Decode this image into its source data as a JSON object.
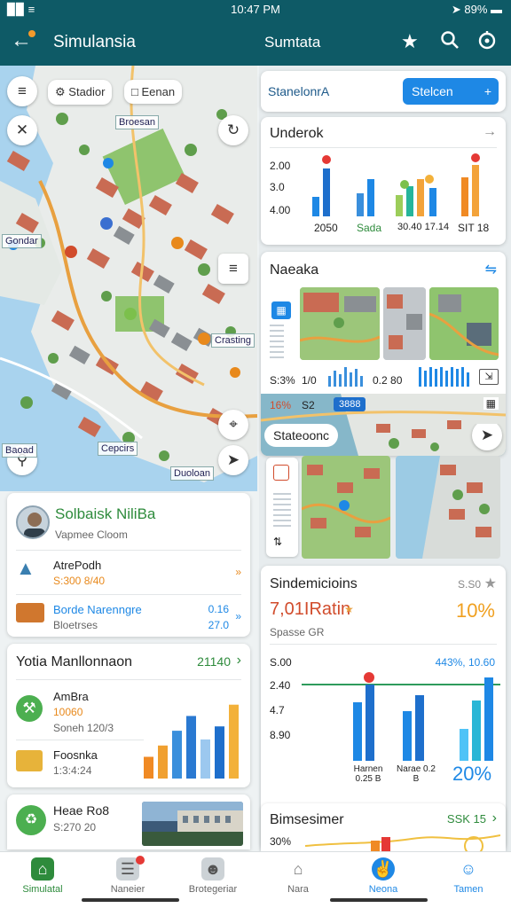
{
  "status": {
    "left": "▉▉ ≡",
    "time": "10:47 PM",
    "right": "➤ 89% ▬"
  },
  "appbar": {
    "title": "Simulansia",
    "center_title": "Sumtata"
  },
  "map": {
    "chip_1": "Stadior",
    "chip_2": "Eenan",
    "labels": [
      "Broesan",
      "Gondar",
      "Crasting",
      "Cepcirs",
      "Baoad",
      "Duoloan"
    ]
  },
  "profile": {
    "name": "Solbaisk NiliBa",
    "subtitle": "Vapmee Cloom",
    "rows": [
      {
        "title": "AtrePodh",
        "value": "S:300 8/40"
      },
      {
        "title": "Borde Narenngre",
        "value": "Bloetrses",
        "right_top": "0.16",
        "right_bottom": "27.0"
      }
    ]
  },
  "mainten": {
    "title": "Yotia Manllonnaon",
    "value": "21140",
    "rows": [
      {
        "title": "AmBra",
        "value": "10060",
        "sub": "Soneh 120/3"
      },
      {
        "title": "Foosnka",
        "value": "1:3:4:24"
      }
    ],
    "bars": [
      {
        "v": 0.25,
        "c": "#f08a24"
      },
      {
        "v": 0.38,
        "c": "#f0a030"
      },
      {
        "v": 0.55,
        "c": "#3a8fdc"
      },
      {
        "v": 0.72,
        "c": "#2a79d1"
      },
      {
        "v": 0.45,
        "c": "#9cc8ef"
      },
      {
        "v": 0.6,
        "c": "#1e6fcc"
      },
      {
        "v": 0.85,
        "c": "#f3b13a"
      }
    ]
  },
  "bottom_left": {
    "title": "Heae Ro8",
    "value": "S:270 20"
  },
  "right": {
    "search_value": "StanelonrA",
    "search_button": "Stelcen",
    "undero": {
      "title": "Underok",
      "yticks": [
        "2.00",
        "3.0",
        "4.00"
      ],
      "xlabels": [
        "2050",
        "Sada",
        "30.40 17.14",
        "SIT 18"
      ]
    },
    "naeaka": {
      "title": "Naeaka",
      "stat_1": "S:3%",
      "stat_2": "1/0",
      "stat_3": "0.2 80",
      "stat_4": "16%",
      "stat_5": "S2",
      "badge": "3888"
    },
    "stateoonc": {
      "title": "Stateoonc"
    },
    "sinde": {
      "title": "Sindemicioins",
      "corner": "S.S0",
      "big_left": "7,01IRatin",
      "big_right": "10%",
      "sub": "Spasse GR",
      "yticks": [
        "S.00",
        "2.40",
        "4.7",
        "8.90"
      ],
      "legend": "443%, 10.60",
      "xlabels": [
        "Harnen 0.25 B",
        "Narae 0.2 B"
      ],
      "percent": "20%"
    },
    "bims": {
      "title": "Bimsesimer",
      "value": "SSK 15",
      "stat": "30%"
    }
  },
  "nav": [
    "Simulatal",
    "Naneier",
    "Brotegeriar",
    "Nara",
    "Neona",
    "Tamen"
  ]
}
